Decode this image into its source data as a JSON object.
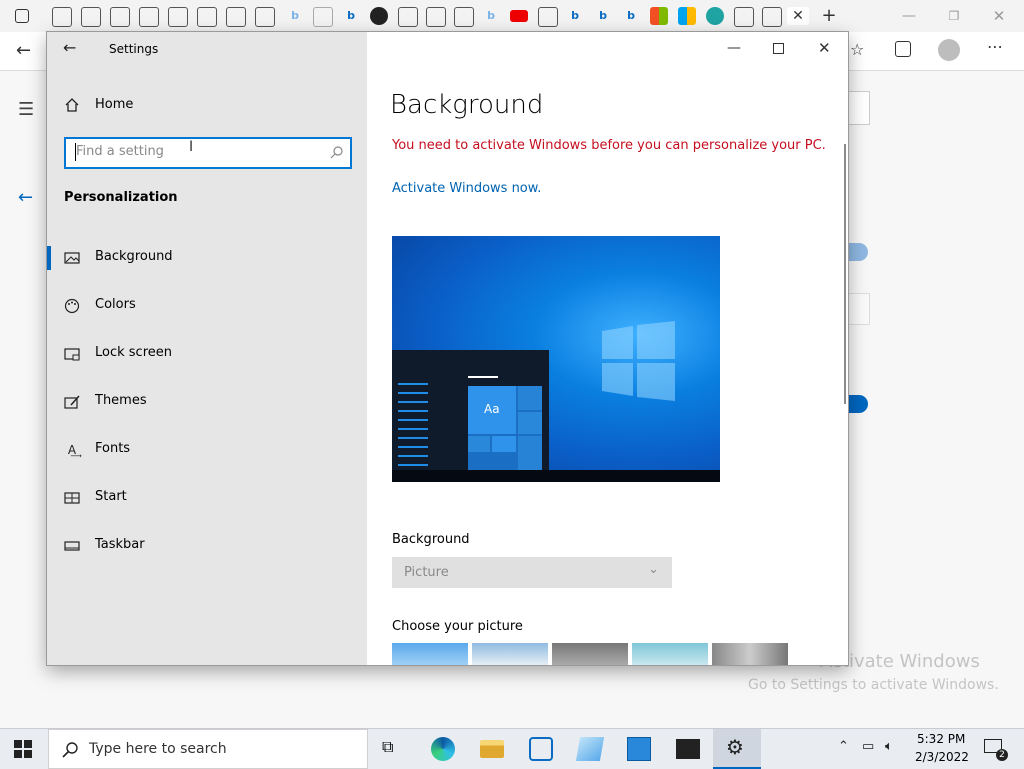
{
  "settings": {
    "title": "Settings",
    "home_label": "Home",
    "search_placeholder": "Find a setting",
    "section_heading": "Personalization",
    "nav": [
      {
        "label": "Background",
        "icon": "image-icon"
      },
      {
        "label": "Colors",
        "icon": "palette-icon"
      },
      {
        "label": "Lock screen",
        "icon": "lock-screen-icon"
      },
      {
        "label": "Themes",
        "icon": "themes-icon"
      },
      {
        "label": "Fonts",
        "icon": "fonts-icon"
      },
      {
        "label": "Start",
        "icon": "start-icon"
      },
      {
        "label": "Taskbar",
        "icon": "taskbar-icon"
      }
    ]
  },
  "content": {
    "heading": "Background",
    "warning": "You need to activate Windows before you can personalize your PC.",
    "activate_link": "Activate Windows now.",
    "preview_tile_text": "Aa",
    "background_label": "Background",
    "background_value": "Picture",
    "choose_picture_label": "Choose your picture"
  },
  "watermark": {
    "line1": "Activate Windows",
    "line2": "Go to Settings to activate Windows."
  },
  "taskbar": {
    "search_placeholder": "Type here to search",
    "time": "5:32 PM",
    "date": "2/3/2022",
    "notification_count": "2"
  },
  "colors": {
    "accent": "#0067c0",
    "warning": "#c50f1f",
    "link": "#0063b1"
  }
}
